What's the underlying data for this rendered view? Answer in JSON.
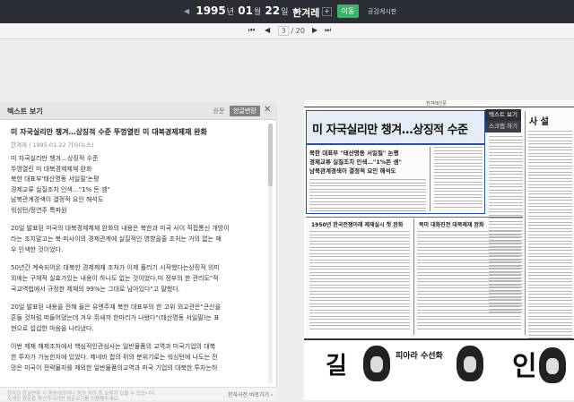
{
  "topbar": {
    "prev_year": "◀",
    "year": "1995",
    "year_unit": "년",
    "month": "01",
    "month_unit": "월",
    "day": "22",
    "day_unit": "일",
    "next_day": "▶",
    "newspaper": "한겨레",
    "expand": "+",
    "go_button": "이동",
    "notice": "공감게시판"
  },
  "navbar": {
    "first": "⏮",
    "prev": "◀",
    "current_page": "3",
    "total_pages": "/ 20",
    "next": "▶",
    "last": "⏭"
  },
  "text_panel": {
    "header_title": "텍스트 보기",
    "original_tab": "원문",
    "convert_tab": "한글변환",
    "close": "✕",
    "article_title": "미 자국실리만 챙겨…상징적 수준 뚜껑열린 미 대북경제제재 완화",
    "article_meta": "한겨레 | 1995.01.22 기사(뉴스)",
    "headline_lines": [
      "미 자국실리만 챙겨…상징적 수준",
      "뚜껑열린 미 대북경제제재 완화",
      "북한 대표부'태산명동 서일필'논평",
      "경제교류 실질조치 인색…\"1% 돈 셈\"",
      "남북관계경색이 결정적 요인 해석도",
      "워싱턴/정연주 특파원"
    ],
    "paragraphs": [
      [
        "20일 발표된 미국의 대북경제제재 완화의 내용은 북한과 미국 사이 직접통신 개방이",
        "라는 조치말고는 북·미사이의 경제관계에 실질적인 영향을줄 조처는 거의 없는 매",
        "우 인색한 것이었다."
      ],
      [
        "50년간 계속되어온 대북한 경제제재 조처가 이제 풀리기 시작했다는상징적 의미",
        "외에는 구체적 실효가있는 내용이 하나도 없는 것이었다.미 정부의 한 관리도\"적",
        "국교역법에서 규정한 제재의 99%는 그대로 남아있다\"고 말했다."
      ],
      [
        "20일 발표된 내용을 전해 들은 유엔주재 북한 대표부의 한 고위 외교관은\"큰산을",
        "흔들 것처럼 떠들어댔는데 겨우 쥐새끼 한마리가 나왔다\"(태산명동 서일필)는 표",
        "현으로 섭섭한 마음을 나타냈다."
      ],
      [
        "이번 제재 해제조처에서 핵심적인관심사는 일반물품의 교역과 미국기업의 대북",
        "한 투자가 가능한지에 있었다. 제네바 합의 뒤의 분위기로는 워싱턴에 나도는 전",
        "망은 미국이 전략물자를 제외한 일반물품의교역과 미국 기업의 대북한 투자는허"
      ]
    ],
    "footer_line1": "한자의 한글변환 시 동음이의어나 음의 차이 등 오류가 있을 수 있습니다.",
    "footer_line2": "자세한 원문을 확인하시려면 원문보기를 이용해주세요.",
    "hanja_link": "한자사전 바로가기 ›"
  },
  "newspaper": {
    "masthead": "한겨레신문",
    "headline": "미 자국실리만 챙겨…상징적 수준",
    "text_view_button": "텍스트 보기",
    "scrap_button": "스크랩 하기",
    "sub_lines": [
      "북한 대표부 \"태산명동 서일필\" 논평",
      "경제교류 실질조치 인색…\"1%돈 셈\"",
      "남북관계경색이 결정적 요인 해석도"
    ],
    "right_title": "사 설",
    "mid_left": "1950년 한국전쟁이래 제재실시 첫 완화",
    "mid_right": "북미 대화진전 대북제재 완화",
    "ad_text": "피아라 수선화",
    "ad_big1": "인",
    "ad_big2": "길"
  }
}
